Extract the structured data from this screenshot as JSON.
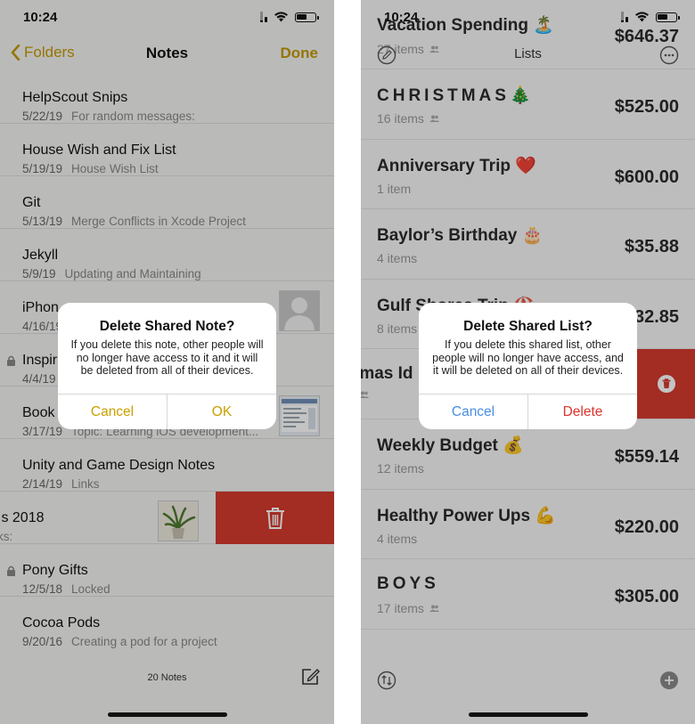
{
  "left": {
    "status": {
      "time": "10:24"
    },
    "nav": {
      "back_label": "Folders",
      "title": "Notes",
      "done_label": "Done"
    },
    "notes": [
      {
        "title": "HelpScout Snips",
        "date": "5/22/19",
        "preview": "For random messages:"
      },
      {
        "title": "House Wish and Fix List",
        "date": "5/19/19",
        "preview": "House Wish List"
      },
      {
        "title": "Git",
        "date": "5/13/19",
        "preview": "Merge Conflicts in Xcode Project"
      },
      {
        "title": "Jekyll",
        "date": "5/9/19",
        "preview": "Updating and Maintaining"
      },
      {
        "title": "iPhon",
        "date": "4/16/19",
        "preview": ""
      },
      {
        "title": "Inspir",
        "date": "4/4/19",
        "preview": ""
      },
      {
        "title": "Book",
        "date": "3/17/19",
        "preview": "Topic: Learning iOS development..."
      },
      {
        "title": "Unity and Game Design Notes",
        "date": "2/14/19",
        "preview": "Links"
      },
      {
        "title": "ıs 2018",
        "date": "",
        "preview": "ks:"
      },
      {
        "title": "Pony Gifts",
        "date": "12/5/18",
        "preview": "Locked"
      },
      {
        "title": "Cocoa Pods",
        "date": "9/20/16",
        "preview": "Creating a pod for a project"
      }
    ],
    "note_count": "20 Notes",
    "alert": {
      "title": "Delete Shared Note?",
      "message": "If you delete this note, other people will no longer have access to it and it will be deleted from all of their devices.",
      "cancel_label": "Cancel",
      "ok_label": "OK"
    }
  },
  "right": {
    "status": {
      "time": "10:24"
    },
    "nav": {
      "title": "Lists"
    },
    "lists": [
      {
        "name": "Vacation Spending 🏝️",
        "count": "27 items",
        "total": "$646.37",
        "shared": true
      },
      {
        "name": "CHRISTMAS🎄",
        "count": "16 items",
        "total": "$525.00",
        "shared": true
      },
      {
        "name": "Anniversary Trip ❤️",
        "count": "1 item",
        "total": "$600.00",
        "shared": false
      },
      {
        "name": "Baylor’s Birthday 🎂",
        "count": "4 items",
        "total": "$35.88",
        "shared": false
      },
      {
        "name": "Gulf Shores Trip 🏖️",
        "count": "8 items",
        "total": "$32.85",
        "shared": false
      },
      {
        "name": "tmas Id",
        "count": "",
        "total": "",
        "shared": true
      },
      {
        "name": "Weekly Budget 💰",
        "count": "12 items",
        "total": "$559.14",
        "shared": false
      },
      {
        "name": "Healthy Power Ups 💪",
        "count": "4 items",
        "total": "$220.00",
        "shared": false
      },
      {
        "name": "BOYS",
        "count": "17 items",
        "total": "$305.00",
        "shared": true
      }
    ],
    "alert": {
      "title": "Delete Shared List?",
      "message": "If you delete this shared list, other people will no longer have access, and it will be deleted on all of their devices.",
      "cancel_label": "Cancel",
      "delete_label": "Delete"
    }
  },
  "colors": {
    "notes_accent": "#c9a000",
    "cancel_blue": "#4a8ee0",
    "delete_red": "#d63a2f"
  }
}
